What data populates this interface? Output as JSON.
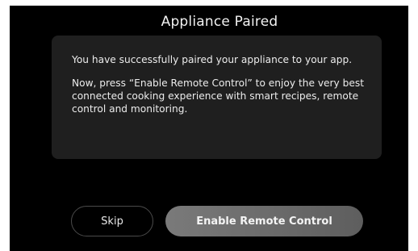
{
  "dialog": {
    "title": "Appliance Paired",
    "message_1": "You have successfully paired your appliance to your app.",
    "message_2": "Now, press “Enable Remote Control” to enjoy the very best connected cooking experience with smart recipes, remote control and monitoring."
  },
  "actions": {
    "skip_label": "Skip",
    "enable_label": "Enable Remote Control"
  },
  "colors": {
    "background": "#000000",
    "card": "#1f1f1f",
    "primary_button": "#6b6b6b",
    "text": "#f2f2f2"
  },
  "icons": {
    "edge_indicator": "arrow-left-icon"
  }
}
